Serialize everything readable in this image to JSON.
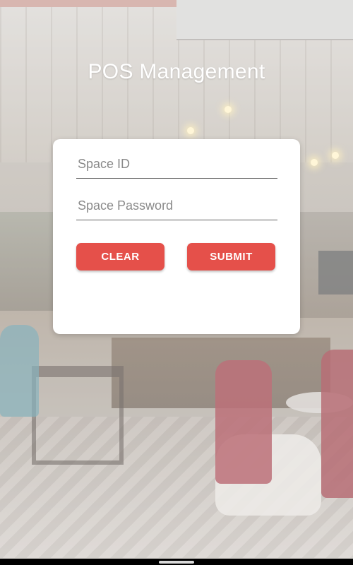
{
  "app": {
    "title": "POS Management"
  },
  "login_form": {
    "space_id": {
      "value": "",
      "placeholder": "Space ID"
    },
    "space_password": {
      "value": "",
      "placeholder": "Space Password"
    },
    "clear_label": "CLEAR",
    "submit_label": "SUBMIT"
  },
  "colors": {
    "accent": "#e5504a",
    "card_background": "#ffffff",
    "title_text": "#ffffff"
  }
}
